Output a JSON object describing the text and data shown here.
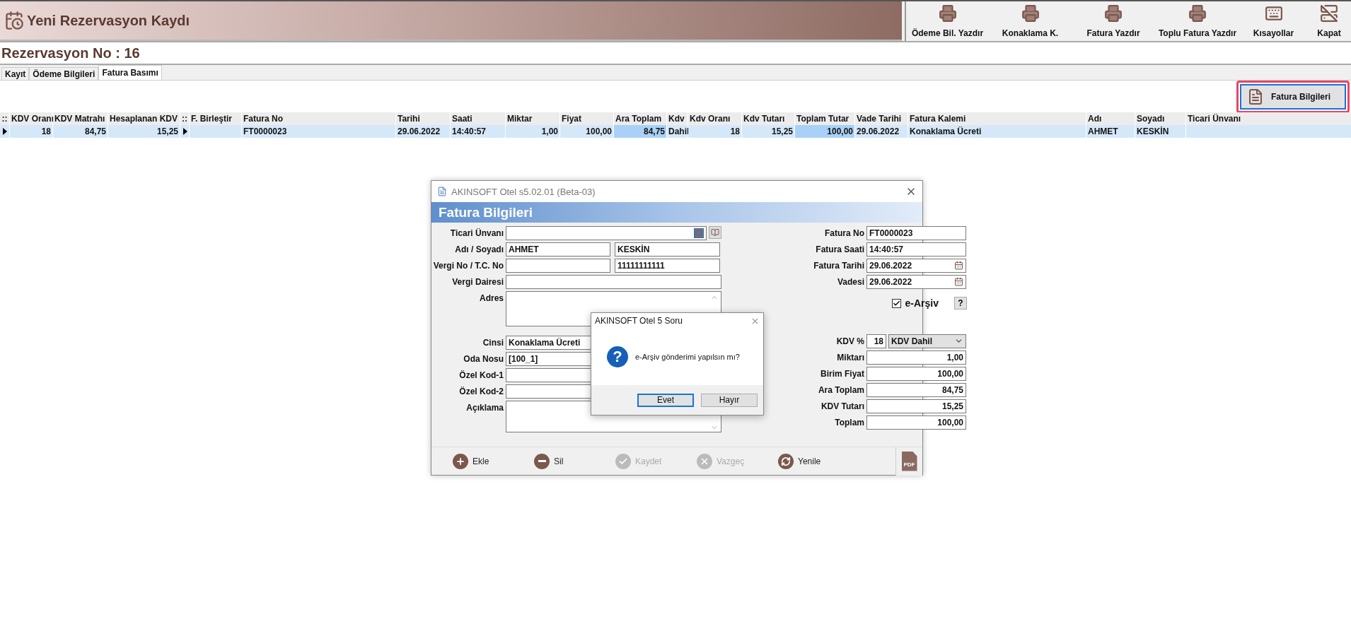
{
  "window": {
    "title": "Yeni Rezervasyon Kaydı"
  },
  "toolbar": [
    {
      "label": "Ödeme Bil. Yazdır",
      "kind": "print"
    },
    {
      "label": "Konaklama K.",
      "kind": "print"
    },
    {
      "label": "Fatura Yazdır",
      "kind": "print"
    },
    {
      "label": "Toplu Fatura Yazdır",
      "kind": "print"
    },
    {
      "label": "Kısayollar",
      "kind": "keyboard"
    },
    {
      "label": "Kapat",
      "kind": "exit"
    }
  ],
  "reservation_title": "Rezervasyon No : 16",
  "tabs": [
    {
      "label": "Kayıt",
      "selected": false
    },
    {
      "label": "Ödeme Bilgileri",
      "selected": false
    },
    {
      "label": "Fatura Basımı",
      "selected": true
    }
  ],
  "invoice_info_button": "Fatura Bilgileri",
  "table": {
    "columns": [
      {
        "label": "::",
        "kind": "marker"
      },
      {
        "label": "KDV Oranı"
      },
      {
        "label": "KDV Matrahı"
      },
      {
        "label": "Hesaplanan KDV"
      },
      {
        "label": "::",
        "kind": "marker"
      },
      {
        "label": "F. Birleştir"
      },
      {
        "label": "Fatura No"
      },
      {
        "label": "Tarihi"
      },
      {
        "label": "Saati"
      },
      {
        "label": "Miktar"
      },
      {
        "label": "Fiyat"
      },
      {
        "label": "Ara Toplam"
      },
      {
        "label": "Kdv"
      },
      {
        "label": "Kdv Oranı"
      },
      {
        "label": "Kdv Tutarı"
      },
      {
        "label": "Toplam Tutar"
      },
      {
        "label": "Vade Tarihi"
      },
      {
        "label": "Fatura Kalemi"
      },
      {
        "label": "Adı"
      },
      {
        "label": "Soyadı"
      },
      {
        "label": "Ticari Ünvanı"
      }
    ],
    "rows": [
      {
        "selected": true,
        "cells": [
          {
            "kind": "pointer"
          },
          {
            "text": "18",
            "numeric": true
          },
          {
            "text": "84,75",
            "numeric": true
          },
          {
            "text": "15,25",
            "numeric": true
          },
          {
            "kind": "pointer"
          },
          {},
          {
            "text": "FT0000023"
          },
          {
            "text": "29.06.2022"
          },
          {
            "text": "14:40:57"
          },
          {
            "text": "1,00",
            "numeric": true
          },
          {
            "text": "100,00",
            "numeric": true
          },
          {
            "text": "84,75",
            "numeric": true,
            "highlighted": true
          },
          {
            "text": "Dahil"
          },
          {
            "text": "18",
            "numeric": true
          },
          {
            "text": "15,25",
            "numeric": true
          },
          {
            "text": "100,00",
            "numeric": true,
            "highlighted": true
          },
          {
            "text": "29.06.2022"
          },
          {
            "text": "Konaklama Ücreti"
          },
          {
            "text": "AHMET"
          },
          {
            "text": "KESKİN"
          },
          {}
        ]
      }
    ]
  },
  "dialog": {
    "title": "AKINSOFT Otel s5.02.01 (Beta-03)",
    "heading": "Fatura Bilgileri",
    "left_fields": [
      {
        "kind": "lookup",
        "label": "Ticari Ünvanı"
      },
      {
        "kind": "pair",
        "label": "Adı / Soyadı",
        "first": "AHMET",
        "second": "KESKİN"
      },
      {
        "kind": "pair",
        "label": "Vergi No / T.C. No",
        "second": "11111111111"
      },
      {
        "kind": "text",
        "label": "Vergi Dairesi"
      },
      {
        "kind": "memo",
        "label": "Adres"
      },
      {
        "kind": "text",
        "label": "Cinsi",
        "value": "Konaklama Ücreti"
      },
      {
        "kind": "text",
        "label": "Oda Nosu",
        "value": "[100_1]"
      },
      {
        "kind": "text",
        "label": "Özel Kod-1"
      },
      {
        "kind": "text",
        "label": "Özel Kod-2"
      },
      {
        "kind": "memo",
        "label": "Açıklama"
      }
    ],
    "right_fields": [
      {
        "kind": "text",
        "label": "Fatura No",
        "value": "FT0000023"
      },
      {
        "kind": "text",
        "label": "Fatura Saati",
        "value": "14:40:57"
      },
      {
        "kind": "date",
        "label": "Fatura Tarihi",
        "value": "29.06.2022"
      },
      {
        "kind": "date",
        "label": "Vadesi",
        "value": "29.06.2022"
      }
    ],
    "e_arsiv": {
      "label": "e-Arşiv",
      "checked": true,
      "help": "?"
    },
    "amount_fields": [
      {
        "kind": "kdv",
        "label": "KDV %",
        "value": "18",
        "select": "KDV Dahil"
      },
      {
        "kind": "number",
        "label": "Miktarı",
        "value": "1,00"
      },
      {
        "kind": "number",
        "label": "Birim Fiyat",
        "value": "100,00"
      },
      {
        "kind": "number",
        "label": "Ara Toplam",
        "value": "84,75"
      },
      {
        "kind": "number",
        "label": "KDV Tutarı",
        "value": "15,25"
      },
      {
        "kind": "number",
        "label": "Toplam",
        "value": "100,00"
      }
    ],
    "actions": [
      {
        "label": "Ekle",
        "kind": "add",
        "disabled": false
      },
      {
        "label": "Sil",
        "kind": "remove",
        "disabled": false
      },
      {
        "label": "Kaydet",
        "kind": "save",
        "disabled": true
      },
      {
        "label": "Vazgeç",
        "kind": "cancel",
        "disabled": true
      },
      {
        "label": "Yenile",
        "kind": "refresh",
        "disabled": false
      }
    ],
    "pdf_label": "PDF"
  },
  "message_box": {
    "title": "AKINSOFT Otel 5 Soru",
    "icon": "?",
    "message": "e-Arşiv gönderimi yapılsın mı?",
    "buttons": [
      {
        "label": "Evet",
        "default": true
      },
      {
        "label": "Hayır",
        "default": false
      }
    ]
  }
}
